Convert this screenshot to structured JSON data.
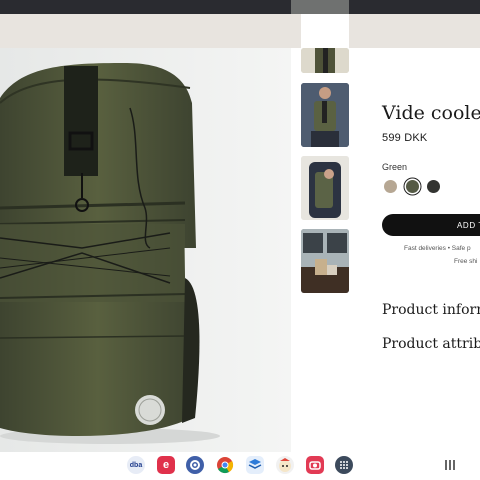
{
  "product": {
    "title": "Vide cooler",
    "price": "599 DKK",
    "color_label": "Green",
    "swatches": [
      {
        "name": "Sand",
        "color": "#b6a793"
      },
      {
        "name": "Green",
        "color": "#555a45",
        "selected": true
      },
      {
        "name": "Black",
        "color": "#333431"
      }
    ],
    "add_button": "ADD T",
    "delivery_line": "Fast deliveries  •  Safe p",
    "shipping_line": "Free shi",
    "sections": [
      "Product inform",
      "Product attribu"
    ]
  },
  "gallery": {
    "thumbnails": [
      "thumb-backpack-top",
      "thumb-person-wearing",
      "thumb-side-view",
      "thumb-window-scene"
    ]
  },
  "dock": {
    "apps": [
      {
        "name": "dba",
        "label": "dba",
        "color": "#e7ecf6"
      },
      {
        "name": "e-app",
        "label": "e",
        "color": "#e0314b"
      },
      {
        "name": "settings",
        "label": "",
        "color": "#3f5fa8"
      },
      {
        "name": "chrome",
        "label": "",
        "color": "#ffffff"
      },
      {
        "name": "files",
        "label": "",
        "color": "#2e7bd8"
      },
      {
        "name": "game",
        "label": "",
        "color": "#f1f1f1"
      },
      {
        "name": "camera",
        "label": "",
        "color": "#e23a54"
      },
      {
        "name": "apps-grid",
        "label": "",
        "color": "#3c4a5c"
      }
    ]
  },
  "colors": {
    "accent": "#111111",
    "banner": "#e8e4df",
    "topbar": "#2a2b30"
  }
}
